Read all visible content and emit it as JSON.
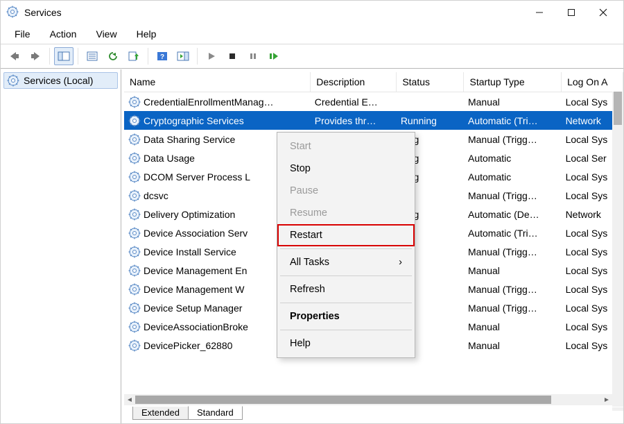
{
  "window": {
    "title": "Services"
  },
  "menubar": [
    "File",
    "Action",
    "View",
    "Help"
  ],
  "nav": {
    "root": "Services (Local)"
  },
  "columns": {
    "name": "Name",
    "description": "Description",
    "status": "Status",
    "startup": "Startup Type",
    "logon": "Log On A"
  },
  "services": [
    {
      "name": "CredentialEnrollmentManag…",
      "desc": "Credential E…",
      "status": "",
      "startup": "Manual",
      "logon": "Local Sys"
    },
    {
      "name": "Cryptographic Services",
      "desc": "Provides thr…",
      "status": "Running",
      "startup": "Automatic (Tri…",
      "logon": "Network",
      "selected": true
    },
    {
      "name": "Data Sharing Service",
      "desc": "",
      "status": "ning",
      "startup": "Manual (Trigg…",
      "logon": "Local Sys"
    },
    {
      "name": "Data Usage",
      "desc": "",
      "status": "ning",
      "startup": "Automatic",
      "logon": "Local Ser"
    },
    {
      "name": "DCOM Server Process L",
      "desc": "",
      "status": "ning",
      "startup": "Automatic",
      "logon": "Local Sys"
    },
    {
      "name": "dcsvc",
      "desc": "",
      "status": "",
      "startup": "Manual (Trigg…",
      "logon": "Local Sys"
    },
    {
      "name": "Delivery Optimization",
      "desc": "",
      "status": "ning",
      "startup": "Automatic (De…",
      "logon": "Network"
    },
    {
      "name": "Device Association Serv",
      "desc": "",
      "status": "",
      "startup": "Automatic (Tri…",
      "logon": "Local Sys"
    },
    {
      "name": "Device Install Service",
      "desc": "",
      "status": "",
      "startup": "Manual (Trigg…",
      "logon": "Local Sys"
    },
    {
      "name": "Device Management En",
      "desc": "",
      "status": "",
      "startup": "Manual",
      "logon": "Local Sys"
    },
    {
      "name": "Device Management W",
      "desc": "",
      "status": "",
      "startup": "Manual (Trigg…",
      "logon": "Local Sys"
    },
    {
      "name": "Device Setup Manager",
      "desc": "",
      "status": "",
      "startup": "Manual (Trigg…",
      "logon": "Local Sys"
    },
    {
      "name": "DeviceAssociationBroke",
      "desc": "",
      "status": "",
      "startup": "Manual",
      "logon": "Local Sys"
    },
    {
      "name": "DevicePicker_62880",
      "desc": "",
      "status": "",
      "startup": "Manual",
      "logon": "Local Sys"
    }
  ],
  "context_menu": {
    "start": "Start",
    "stop": "Stop",
    "pause": "Pause",
    "resume": "Resume",
    "restart": "Restart",
    "all_tasks": "All Tasks",
    "refresh": "Refresh",
    "properties": "Properties",
    "help": "Help"
  },
  "tabs": {
    "extended": "Extended",
    "standard": "Standard"
  },
  "colors": {
    "selection": "#0a64c4",
    "highlight_outline": "#d80000"
  }
}
